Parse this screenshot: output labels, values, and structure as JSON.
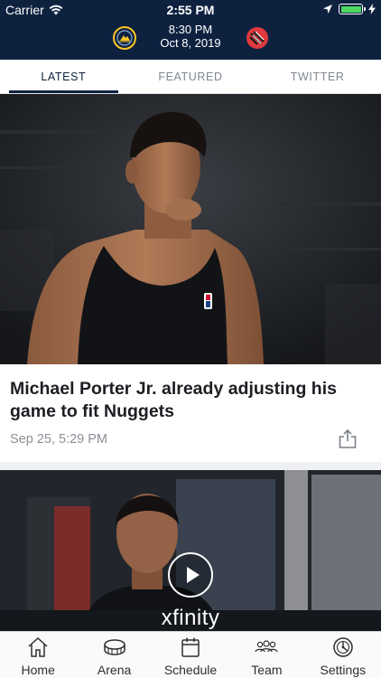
{
  "status_bar": {
    "carrier": "Carrier",
    "time": "2:55 PM"
  },
  "game": {
    "time": "8:30 PM",
    "date": "Oct 8, 2019",
    "home_team_icon": "nuggets-logo-icon",
    "away_team_icon": "trail-blazers-logo-icon"
  },
  "tabs": [
    {
      "label": "LATEST",
      "active": true
    },
    {
      "label": "FEATURED",
      "active": false
    },
    {
      "label": "TWITTER",
      "active": false
    }
  ],
  "articles": [
    {
      "headline": "Michael Porter Jr. already adjusting his game to fit Nuggets",
      "date": "Sep 25, 5:29 PM",
      "share_icon": "share-icon"
    },
    {
      "type": "video",
      "sponsor": "xfinity",
      "play_icon": "play-icon"
    }
  ],
  "bottom_nav": [
    {
      "label": "Home",
      "icon": "home-icon"
    },
    {
      "label": "Arena",
      "icon": "arena-icon"
    },
    {
      "label": "Schedule",
      "icon": "calendar-icon"
    },
    {
      "label": "Team",
      "icon": "team-icon"
    },
    {
      "label": "Settings",
      "icon": "settings-icon"
    }
  ],
  "colors": {
    "header": "#0e2240",
    "accent": "#fec524",
    "battery": "#4cd964"
  }
}
